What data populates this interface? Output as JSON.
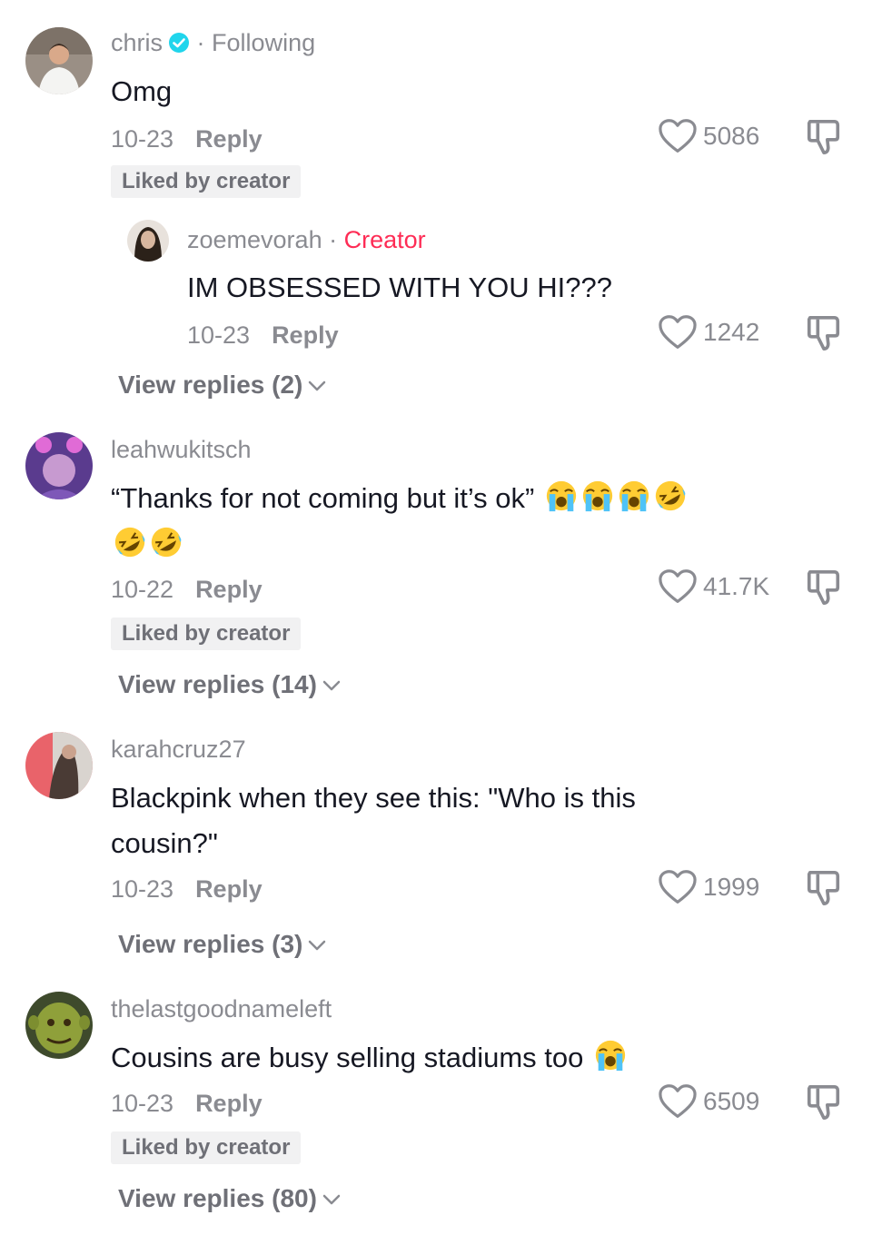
{
  "comments": [
    {
      "username": "chris",
      "verified": true,
      "separator": "·",
      "relation": "Following",
      "text": "Omg",
      "date": "10-23",
      "reply_label": "Reply",
      "likes": "5086",
      "badge": "Liked by creator",
      "reply": {
        "username": "zoemevorah",
        "separator": "·",
        "tag": "Creator",
        "text": "IM OBSESSED WITH YOU HI???",
        "date": "10-23",
        "reply_label": "Reply",
        "likes": "1242"
      },
      "view_replies": "View replies (2)"
    },
    {
      "username": "leahwukitsch",
      "text": "“Thanks for not coming but it’s ok”",
      "emojis": [
        "loudly-crying-face",
        "loudly-crying-face",
        "loudly-crying-face",
        "rolling-on-floor-laughing",
        "rolling-on-floor-laughing",
        "rolling-on-floor-laughing"
      ],
      "date": "10-22",
      "reply_label": "Reply",
      "likes": "41.7K",
      "badge": "Liked by creator",
      "view_replies": "View replies (14)"
    },
    {
      "username": "karahcruz27",
      "text_line1": "Blackpink when they see this: \"Who is this",
      "text_line2": "cousin?\"",
      "date": "10-23",
      "reply_label": "Reply",
      "likes": "1999",
      "view_replies": "View replies (3)"
    },
    {
      "username": "thelastgoodnameleft",
      "text": "Cousins are busy selling stadiums too",
      "emojis": [
        "loudly-crying-face"
      ],
      "date": "10-23",
      "reply_label": "Reply",
      "likes": "6509",
      "badge": "Liked by creator",
      "view_replies": "View replies (80)"
    }
  ],
  "icons": {
    "like": "heart-outline-icon",
    "dislike": "thumbs-down-icon",
    "expand": "chevron-down-icon",
    "verified": "verified-badge-icon"
  },
  "colors": {
    "text": "#161823",
    "secondary": "#8a8b91",
    "creator": "#fe2c55",
    "verified": "#20d5ec",
    "badge_bg": "#f1f1f2"
  }
}
